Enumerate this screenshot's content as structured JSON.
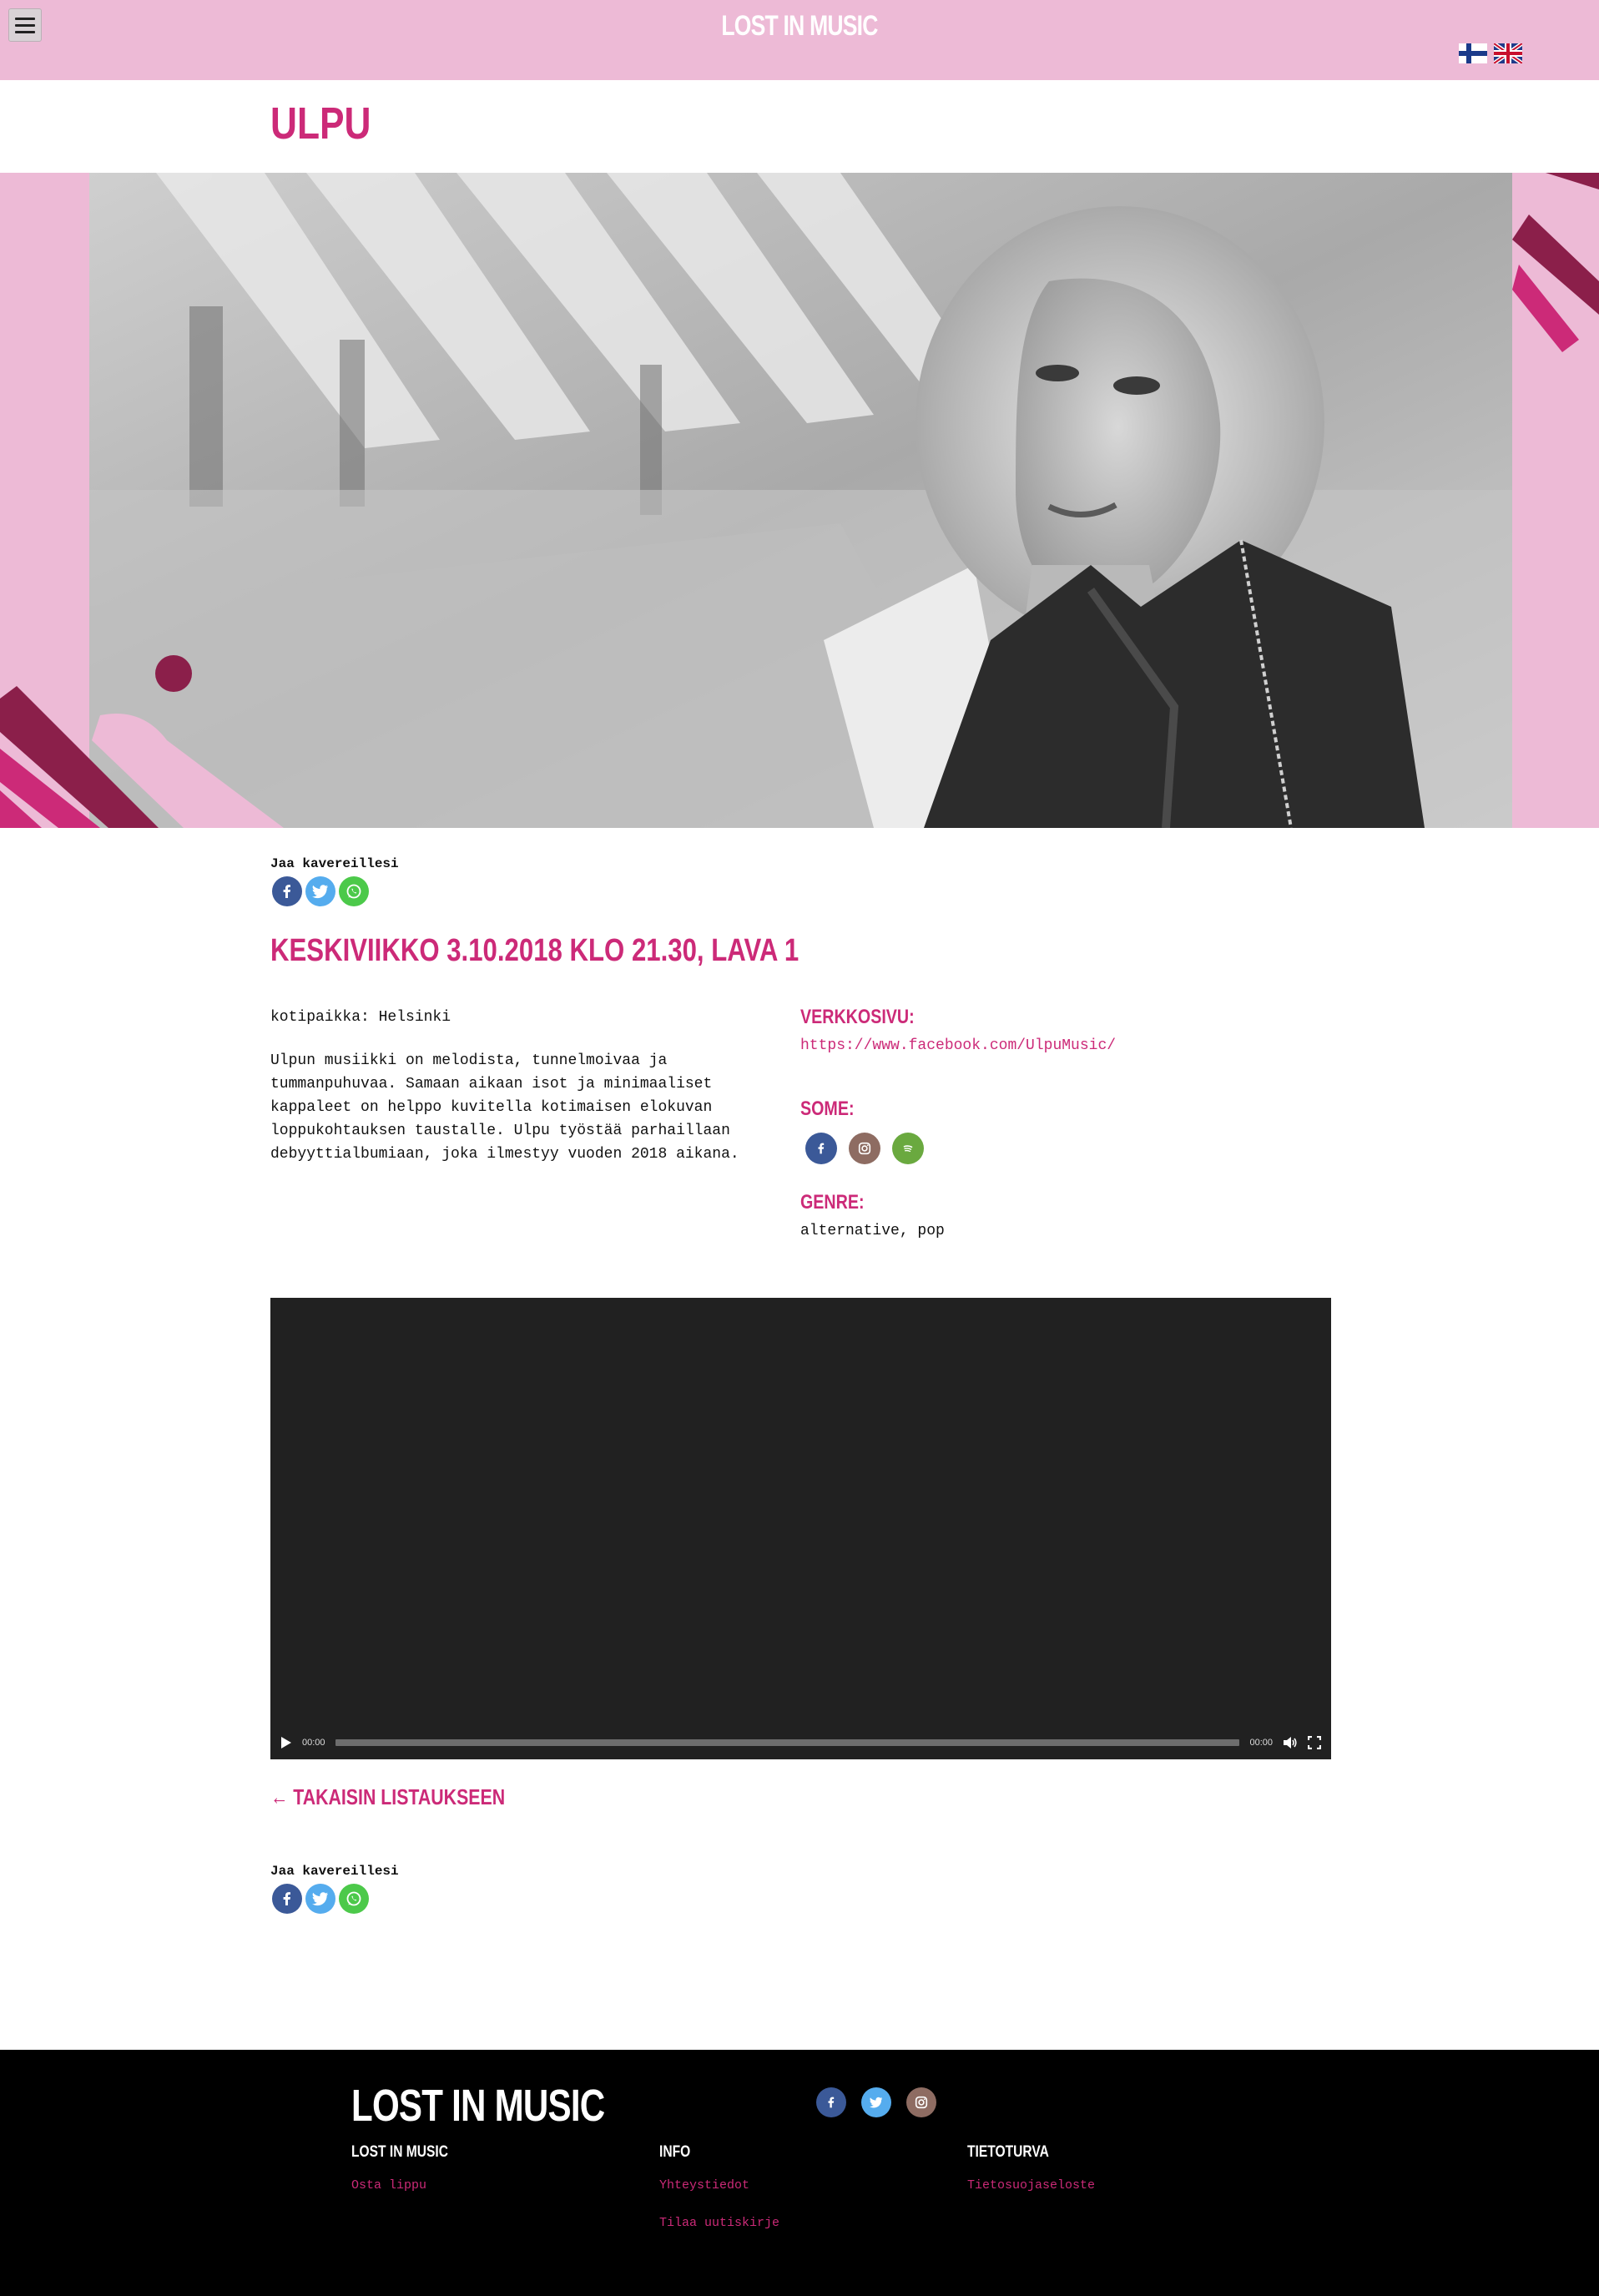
{
  "header": {
    "logo": "LOST IN MUSIC",
    "languages": [
      "suomi",
      "english"
    ]
  },
  "artist": {
    "name": "ULPU"
  },
  "share": {
    "label": "Jaa kavereillesi",
    "buttons": [
      "facebook-icon",
      "twitter-icon",
      "whatsapp-icon"
    ]
  },
  "event": {
    "date_line": "KESKIVIIKKO 3.10.2018 KLO 21.30, LAVA 1",
    "hometown": "kotipaikka: Helsinki",
    "description": "Ulpun musiikki on melodista, tunnelmoivaa ja tummanpuhuvaa. Samaan aikaan isot ja minimaaliset kappaleet on helppo kuvitella kotimaisen elokuvan loppukohtauksen taustalle. Ulpu työstää parhaillaan debyyttialbumiaan, joka ilmestyy vuoden 2018 aikana.",
    "website_heading": "VERKKOSIVU:",
    "website_url": "https://www.facebook.com/UlpuMusic/",
    "some_heading": "SOME:",
    "some_icons": [
      "facebook-icon",
      "instagram-icon",
      "spotify-icon"
    ],
    "genre_heading": "GENRE:",
    "genre_value": "alternative, pop"
  },
  "video": {
    "current_time": "00:00",
    "duration": "00:00",
    "progress": 0
  },
  "back": {
    "label": "TAKAISIN LISTAUKSEEN"
  },
  "footer": {
    "logo": "LOST IN MUSIC",
    "columns": [
      {
        "heading": "LOST IN MUSIC",
        "links": [
          "Osta lippu"
        ]
      },
      {
        "heading": "INFO",
        "links": [
          "Yhteystiedot",
          "Tilaa uutiskirje"
        ]
      },
      {
        "heading": "TIETOTURVA",
        "links": [
          "Tietosuojaseloste"
        ]
      }
    ],
    "social_icons": [
      "facebook-icon",
      "twitter-icon",
      "instagram-icon"
    ]
  },
  "colors": {
    "brand_pink": "#cc2a78",
    "header_pink": "#edbad6",
    "dark_magenta": "#8b1f4a",
    "facebook": "#3b5998",
    "twitter": "#55acee",
    "whatsapp": "#4cc94a",
    "instagram": "#8e6c62",
    "spotify": "#6aa93f"
  }
}
